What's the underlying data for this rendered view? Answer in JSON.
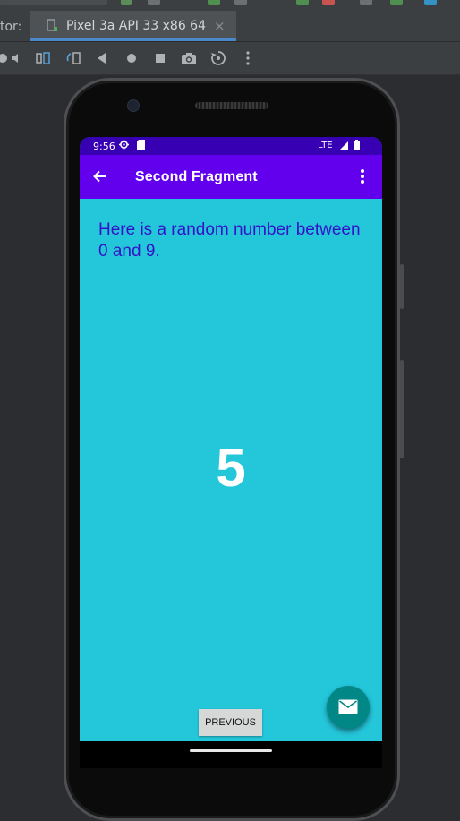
{
  "ide": {
    "tabbar_prefix": "tor:",
    "tab_label": "Pixel 3a API 33 x86 64",
    "tab_close": "×",
    "toolbar_icons": [
      "power-icon",
      "volume-icon",
      "rotate-left-icon",
      "rotate-right-icon",
      "back-icon",
      "home-icon",
      "overview-icon",
      "screenshot-icon",
      "snapshot-icon",
      "more-icon"
    ]
  },
  "device": {
    "status": {
      "time": "9:56",
      "network": "LTE"
    },
    "app_bar": {
      "title": "Second Fragment"
    },
    "content": {
      "intro": "Here is a random number between 0 and 9.",
      "number": "5",
      "previous_button": "PREVIOUS"
    },
    "colors": {
      "status_bar": "#3700b3",
      "app_bar": "#6200ee",
      "background": "#24c6da",
      "intro_text": "#3413c7",
      "fab": "#018786"
    }
  }
}
